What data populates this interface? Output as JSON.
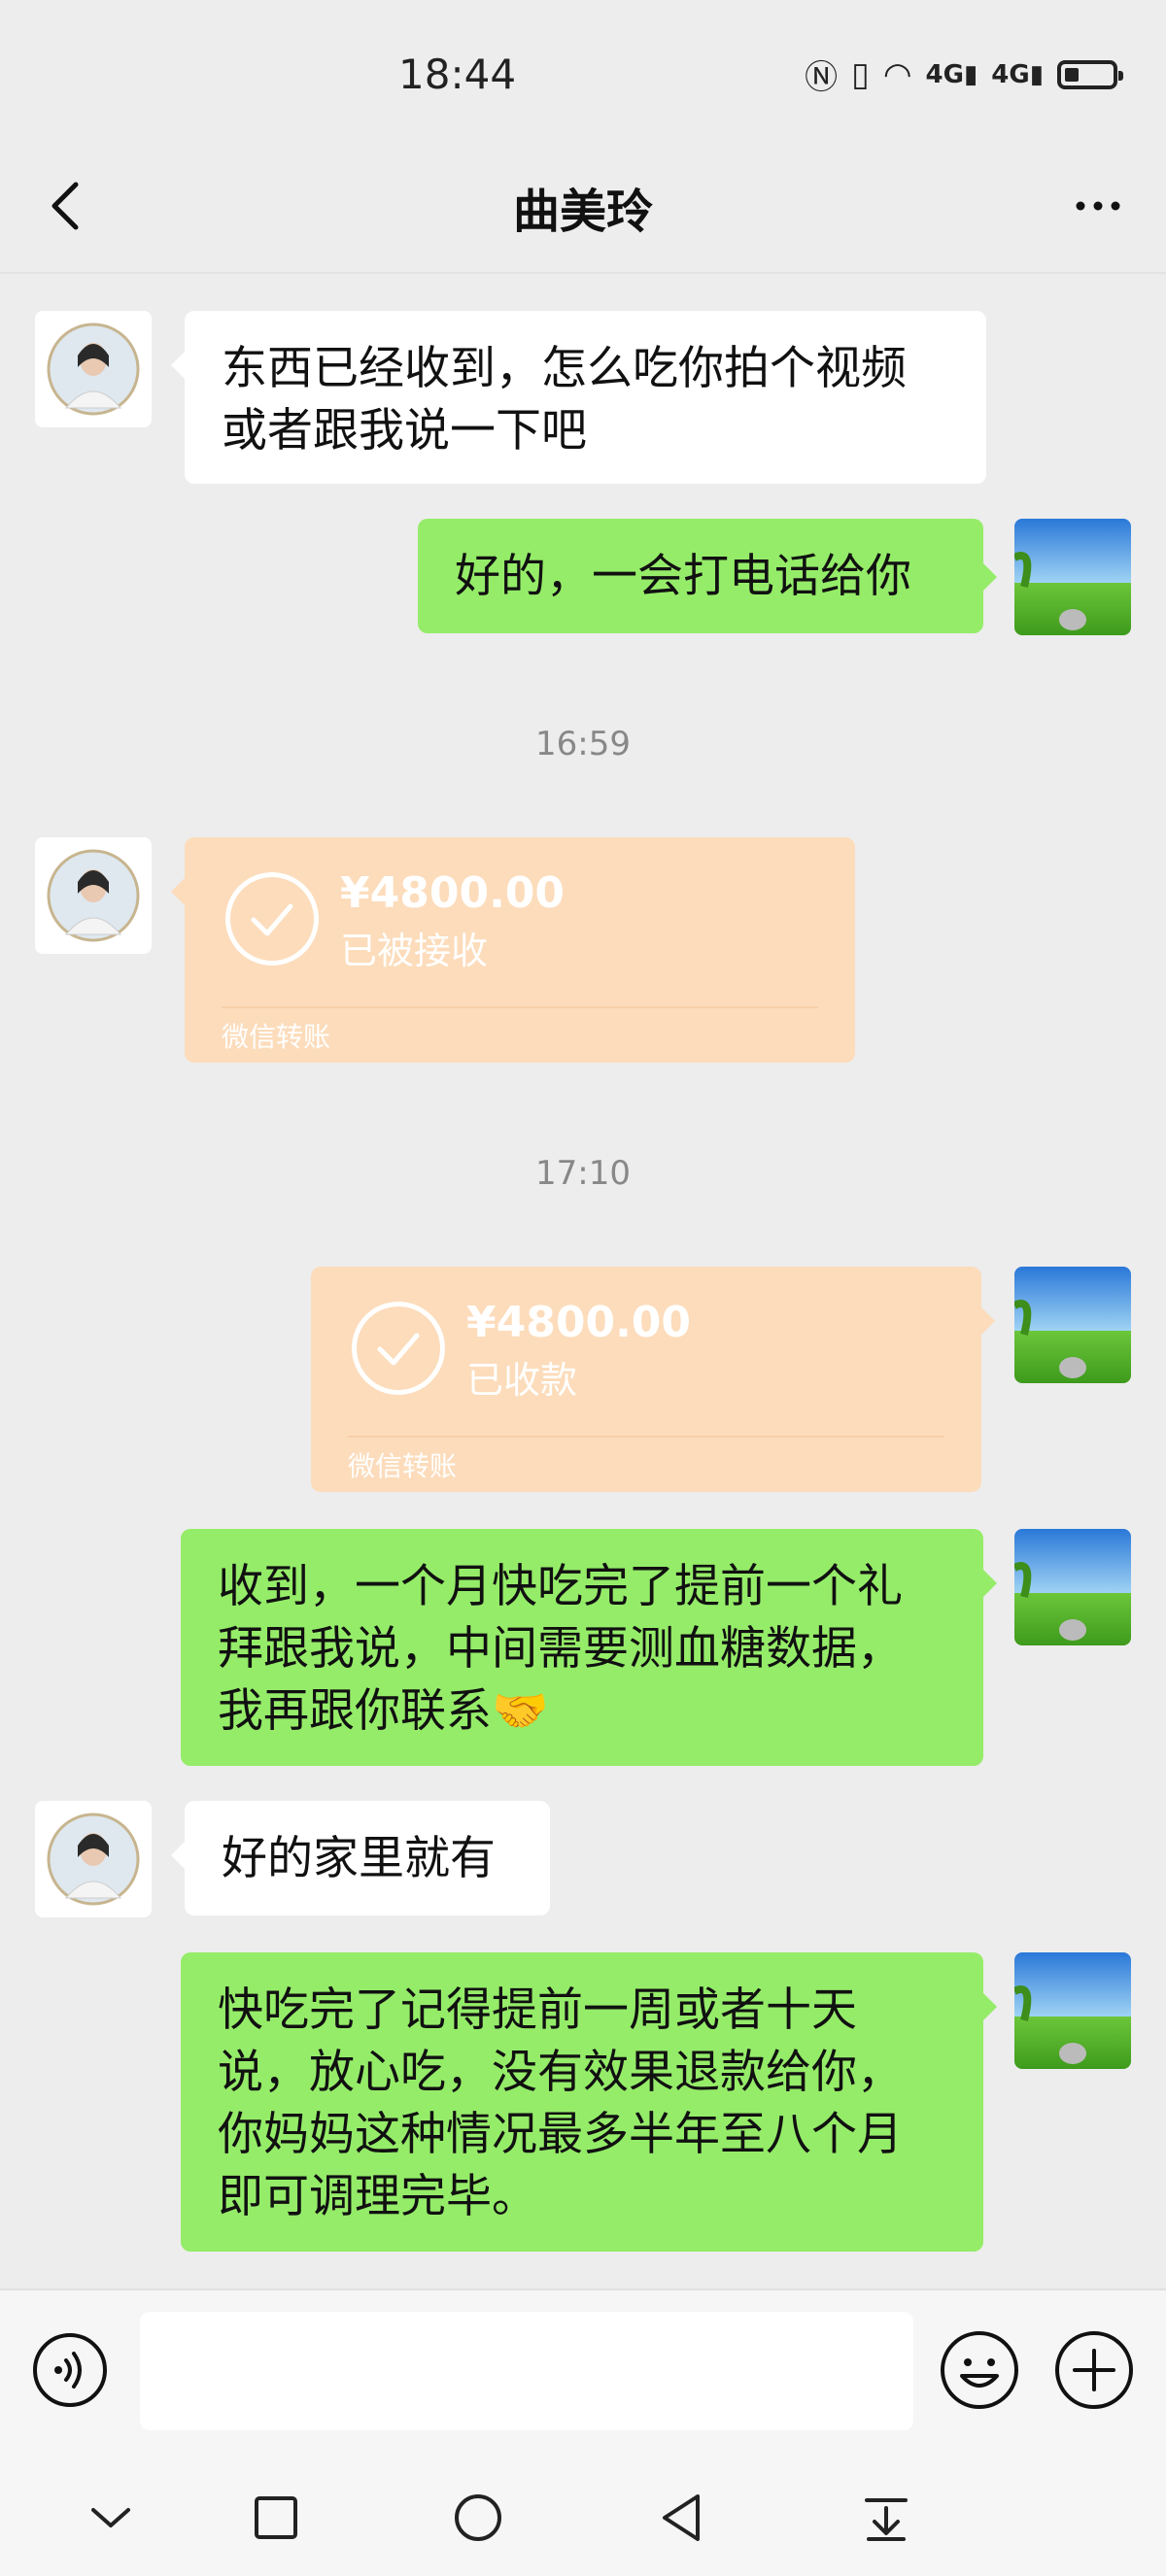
{
  "status_bar": {
    "time": "18:44",
    "network_1": "4G",
    "network_2": "4G",
    "battery_level": 0.3
  },
  "header": {
    "title": "曲美玲"
  },
  "messages": [
    {
      "side": "left",
      "type": "text",
      "text_lines": [
        "东西已经收到，怎么吃你拍个视频",
        "或者跟我说一下吧"
      ]
    },
    {
      "side": "right",
      "type": "text",
      "text_lines": [
        "好的，一会打电话给你"
      ]
    },
    {
      "type": "timestamp",
      "text": "16:59"
    },
    {
      "side": "left",
      "type": "transfer",
      "amount": "¥4800.00",
      "status": "已被接收",
      "label": "微信转账"
    },
    {
      "type": "timestamp",
      "text": "17:10"
    },
    {
      "side": "right",
      "type": "transfer",
      "amount": "¥4800.00",
      "status": "已收款",
      "label": "微信转账"
    },
    {
      "side": "right",
      "type": "text",
      "text_lines": [
        "收到，一个月快吃完了提前一个礼",
        "拜跟我说，中间需要测血糖数据，",
        "我再跟你联系🤝"
      ]
    },
    {
      "side": "left",
      "type": "text",
      "text_lines": [
        "好的家里就有"
      ]
    },
    {
      "side": "right",
      "type": "text",
      "text_lines": [
        "快吃完了记得提前一周或者十天",
        "说，放心吃，没有效果退款给你，",
        "你妈妈这种情况最多半年至八个月",
        "即可调理完毕。"
      ]
    }
  ],
  "input": {
    "value": "",
    "voice_icon": "voice-icon",
    "emoji_icon": "emoji-icon",
    "plus_icon": "plus-icon"
  },
  "colors": {
    "background": "#ededed",
    "bubble_green": "#95ec69",
    "bubble_white": "#ffffff",
    "transfer_bg": "#fcdcbb"
  }
}
